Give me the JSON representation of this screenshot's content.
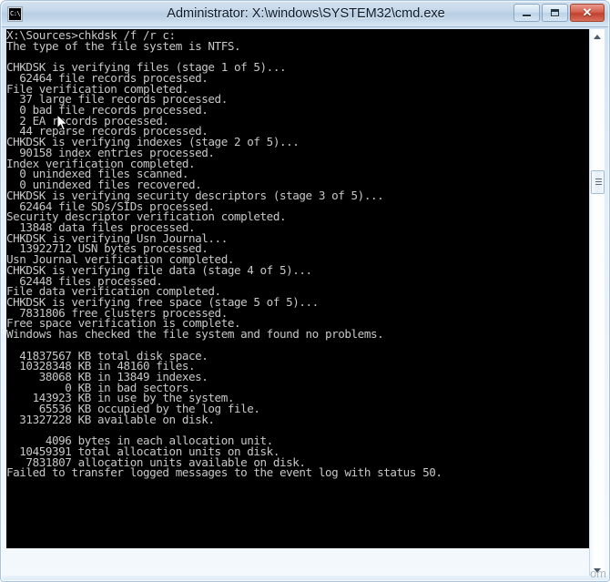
{
  "window": {
    "title": "Administrator: X:\\windows\\SYSTEM32\\cmd.exe",
    "icon_name": "cmd-console-icon",
    "icon_glyph": "C:\\",
    "frame_accent": "#b9cee3",
    "close_button_color": "#c0402e",
    "controls": {
      "minimize_label": "Minimize",
      "maximize_label": "Maximize",
      "close_label": "✕"
    }
  },
  "console": {
    "background": "#000000",
    "foreground": "#c8c8c8",
    "prompt": "X:\\Sources>",
    "command": "chkdsk /f /r c:",
    "lines": [
      "X:\\Sources>chkdsk /f /r c:",
      "The type of the file system is NTFS.",
      "",
      "CHKDSK is verifying files (stage 1 of 5)...",
      "  62464 file records processed.",
      "File verification completed.",
      "  37 large file records processed.",
      "  0 bad file records processed.",
      "  2 EA records processed.",
      "  44 reparse records processed.",
      "CHKDSK is verifying indexes (stage 2 of 5)...",
      "  90158 index entries processed.",
      "Index verification completed.",
      "  0 unindexed files scanned.",
      "  0 unindexed files recovered.",
      "CHKDSK is verifying security descriptors (stage 3 of 5)...",
      "  62464 file SDs/SIDs processed.",
      "Security descriptor verification completed.",
      "  13848 data files processed.",
      "CHKDSK is verifying Usn Journal...",
      "  13922712 USN bytes processed.",
      "Usn Journal verification completed.",
      "CHKDSK is verifying file data (stage 4 of 5)...",
      "  62448 files processed.",
      "File data verification completed.",
      "CHKDSK is verifying free space (stage 5 of 5)...",
      "  7831806 free clusters processed.",
      "Free space verification is complete.",
      "Windows has checked the file system and found no problems.",
      "",
      "  41837567 KB total disk space.",
      "  10328348 KB in 48160 files.",
      "     38068 KB in 13849 indexes.",
      "         0 KB in bad sectors.",
      "    143923 KB in use by the system.",
      "     65536 KB occupied by the log file.",
      "  31327228 KB available on disk.",
      "",
      "      4096 bytes in each allocation unit.",
      "  10459391 total allocation units on disk.",
      "   7831807 allocation units available on disk.",
      "Failed to transfer logged messages to the event log with status 50."
    ],
    "summary": {
      "total_disk_space_kb": 41837567,
      "in_files_kb": 10328348,
      "file_count": 48160,
      "in_indexes_kb": 38068,
      "index_count": 13849,
      "bad_sectors_kb": 0,
      "in_use_by_system_kb": 143923,
      "log_file_kb": 65536,
      "available_on_disk_kb": 31327228,
      "bytes_per_allocation_unit": 4096,
      "total_allocation_units": 10459391,
      "available_allocation_units": 7831807,
      "event_log_status": 50
    },
    "stage_counts": {
      "file_records_processed": 62464,
      "large_file_records": 37,
      "bad_file_records": 0,
      "ea_records": 2,
      "reparse_records": 44,
      "index_entries_processed": 90158,
      "unindexed_files_scanned": 0,
      "unindexed_files_recovered": 0,
      "file_sds_sids_processed": 62464,
      "data_files_processed": 13848,
      "usn_bytes_processed": 13922712,
      "files_processed": 62448,
      "free_clusters_processed": 7831806
    },
    "result_message": "Windows has checked the file system and found no problems.",
    "filesystem_type": "NTFS"
  },
  "scrollbar": {
    "up_arrow_name": "scroll-up-arrow",
    "down_arrow_name": "scroll-down-arrow",
    "thumb_name": "scrollbar-thumb"
  },
  "watermark": {
    "text": "om"
  }
}
